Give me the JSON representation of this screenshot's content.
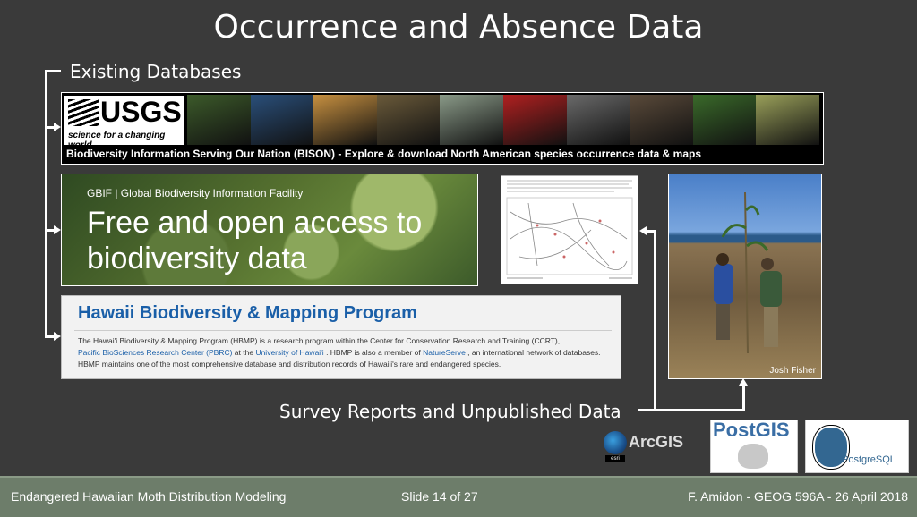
{
  "slide": {
    "title": "Occurrence and Absence Data",
    "subtitle": "Existing Databases",
    "survey_label": "Survey Reports and Unpublished Data"
  },
  "usgs": {
    "logo_word": "USGS",
    "logo_tagline": "science for a changing world",
    "caption": "Biodiversity Information Serving Our Nation (BISON) -  Explore & download North American species occurrence data & maps",
    "strip_colors": [
      "#3c5a2a",
      "#2a4f7a",
      "#c79040",
      "#6a5a3a",
      "#8a9a88",
      "#b02020",
      "#6a6a6a",
      "#5a4a3a",
      "#3a6a2a",
      "#9aa05a"
    ]
  },
  "gbif": {
    "header": "GBIF | Global Biodiversity Information Facility",
    "headline": "Free and open access to biodiversity data"
  },
  "hbmp": {
    "heading": "Hawaii Biodiversity & Mapping Program",
    "body_1": "The Hawai'i Biodiversity & Mapping Program (HBMP) is a research program within the Center for Conservation Research and Training (CCRT),",
    "link_pbrc": "Pacific BioSciences Research Center (PBRC)",
    "body_2": " at the ",
    "link_uh": "University of Hawai'i",
    "body_3": " . HBMP is also a member of ",
    "link_ns": "NatureServe",
    "body_4": " , an international network of databases.  HBMP maintains one of the most comprehensive database and distribution records of Hawai'i's rare and endangered species."
  },
  "photo": {
    "credit": "Josh Fisher"
  },
  "logos": {
    "arcgis": "ArcGIS",
    "esri": "esri",
    "postgis": "PostGIS",
    "postgresql": "PostgreSQL"
  },
  "footer": {
    "left": "Endangered Hawaiian Moth Distribution Modeling",
    "center": "Slide 14 of 27",
    "right": "F. Amidon - GEOG 596A - 26 April 2018"
  }
}
